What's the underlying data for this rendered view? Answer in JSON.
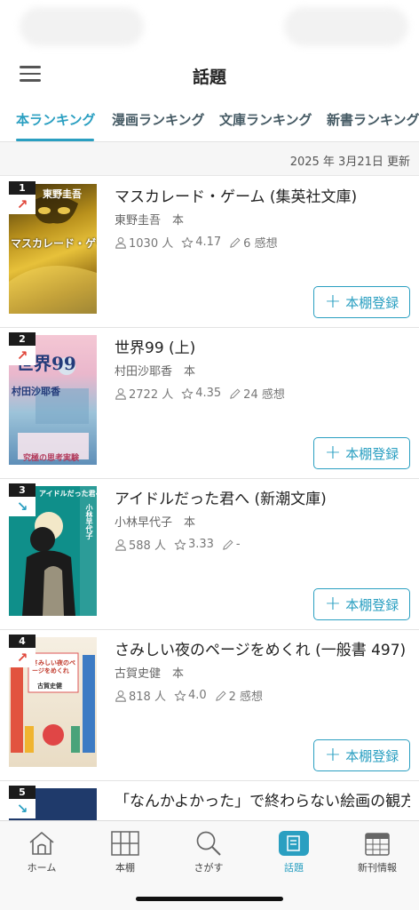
{
  "header": {
    "title": "話題"
  },
  "tabs": [
    {
      "label": "本ランキング",
      "active": true
    },
    {
      "label": "漫画ランキング",
      "active": false
    },
    {
      "label": "文庫ランキング",
      "active": false
    },
    {
      "label": "新書ランキング",
      "active": false
    }
  ],
  "updated": {
    "text": "2025 年 3月21日 更新"
  },
  "register_label": "本棚登録",
  "books": [
    {
      "rank": "1",
      "trend": "up",
      "trend_icon": "arrow-up-right-icon",
      "title": "マスカレード・ゲーム (集英社文庫)",
      "author": "東野圭吾　本",
      "readers": "1030 人",
      "rating": "4.17",
      "reviews": "6 感想",
      "cover_text": "東野圭吾",
      "cover_title": "マスカレード・ゲーム"
    },
    {
      "rank": "2",
      "trend": "up",
      "trend_icon": "arrow-up-right-icon",
      "title": "世界99 (上)",
      "author": "村田沙耶香　本",
      "readers": "2722 人",
      "rating": "4.35",
      "reviews": "24 感想",
      "cover_text": "村田沙耶香",
      "cover_title": "世界99",
      "cover_sub": "究極の思考実験"
    },
    {
      "rank": "3",
      "trend": "down",
      "trend_icon": "arrow-down-right-icon",
      "title": "アイドルだった君へ (新潮文庫)",
      "author": "小林早代子　本",
      "readers": "588 人",
      "rating": "3.33",
      "reviews": "-",
      "cover_text": "小林早代子",
      "cover_title": "アイドルだった君へ"
    },
    {
      "rank": "4",
      "trend": "up",
      "trend_icon": "arrow-up-right-icon",
      "title": "さみしい夜のページをめくれ (一般書 497)",
      "author": "古賀史健　本",
      "readers": "818 人",
      "rating": "4.0",
      "reviews": "2 感想",
      "cover_text": "古賀史健",
      "cover_title": "さみしい夜のページをめくれ"
    },
    {
      "rank": "5",
      "trend": "down",
      "trend_icon": "arrow-down-right-icon",
      "title": "「なんかよかった」で終わらない絵画の観方"
    }
  ],
  "tabbar": [
    {
      "label": "ホーム",
      "icon": "home-icon",
      "active": false
    },
    {
      "label": "本棚",
      "icon": "bookshelf-icon",
      "active": false
    },
    {
      "label": "さがす",
      "icon": "search-icon",
      "active": false
    },
    {
      "label": "話題",
      "icon": "topic-book-icon",
      "active": true
    },
    {
      "label": "新刊情報",
      "icon": "calendar-icon",
      "active": false
    }
  ],
  "colors": {
    "accent": "#2a9fc1",
    "trend_up": "#e0463a",
    "trend_down": "#2a9fc1"
  }
}
